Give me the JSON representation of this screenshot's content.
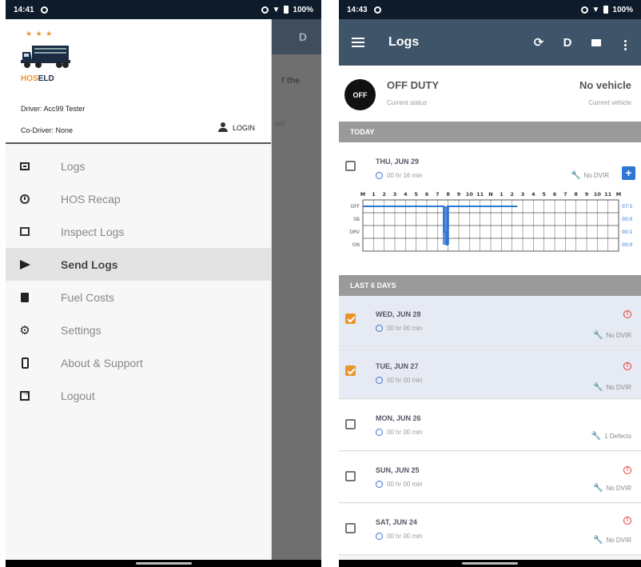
{
  "left": {
    "status_bar": {
      "time": "14:41",
      "battery": "100%"
    },
    "background_appbar_action": "D",
    "background_text_1": "f the",
    "background_text_2": "ast",
    "drawer": {
      "logo": {
        "stars": "★ ★ ★",
        "brand_hos": "HOS",
        "brand_eld": "ELD"
      },
      "driver": "Driver: Acc99 Tester",
      "co_driver": "Co-Driver: None",
      "login_label": "LOGIN",
      "items": [
        {
          "label": "Logs",
          "icon": "logs-icon"
        },
        {
          "label": "HOS Recap",
          "icon": "alarm-clock-icon"
        },
        {
          "label": "Inspect Logs",
          "icon": "inspect-icon"
        },
        {
          "label": "Send Logs",
          "icon": "send-icon",
          "active": true
        },
        {
          "label": "Fuel Costs",
          "icon": "fuel-pump-icon"
        },
        {
          "label": "Settings",
          "icon": "gear-icon"
        },
        {
          "label": "About & Support",
          "icon": "phone-icon"
        },
        {
          "label": "Logout",
          "icon": "logout-icon"
        }
      ]
    }
  },
  "right": {
    "status_bar": {
      "time": "14:43",
      "battery": "100%"
    },
    "appbar": {
      "title": "Logs",
      "d_label": "D"
    },
    "status": {
      "badge": "OFF",
      "duty": "OFF DUTY",
      "duty_sub": "Current status",
      "vehicle": "No vehicle",
      "vehicle_sub": "Current vehicle"
    },
    "today_header": "TODAY",
    "today": {
      "date": "THU, JUN 29",
      "duration": "00 hr 16 min",
      "dvir": "No DVIR",
      "plus": "+",
      "hours_row": [
        "M",
        "1",
        "2",
        "3",
        "4",
        "5",
        "6",
        "7",
        "8",
        "9",
        "10",
        "11",
        "N",
        "1",
        "2",
        "3",
        "4",
        "5",
        "6",
        "7",
        "8",
        "9",
        "10",
        "11",
        "M"
      ],
      "rows": [
        "OFF",
        "SB",
        "DRV",
        "ON"
      ],
      "totals": [
        "07:5",
        "00:0",
        "00:1",
        "00:0"
      ]
    },
    "last_header": "LAST 6 DAYS",
    "days": [
      {
        "date": "WED, JUN 28",
        "duration": "00 hr 00 min",
        "dvir": "No DVIR",
        "checked": true,
        "warning": true
      },
      {
        "date": "TUE, JUN 27",
        "duration": "00 hr 00 min",
        "dvir": "No DVIR",
        "checked": true,
        "warning": true
      },
      {
        "date": "MON, JUN 26",
        "duration": "00 hr 00 min",
        "dvir": "1 Defects",
        "checked": false,
        "warning": false
      },
      {
        "date": "SUN, JUN 25",
        "duration": "00 hr 00 min",
        "dvir": "No DVIR",
        "checked": false,
        "warning": true
      },
      {
        "date": "SAT, JUN 24",
        "duration": "00 hr 00 min",
        "dvir": "No DVIR",
        "checked": false,
        "warning": true
      }
    ],
    "colors": {
      "accent": "#e8962b",
      "appbar": "#3f5468",
      "link": "#2d76d3",
      "warning": "#e33333"
    }
  }
}
